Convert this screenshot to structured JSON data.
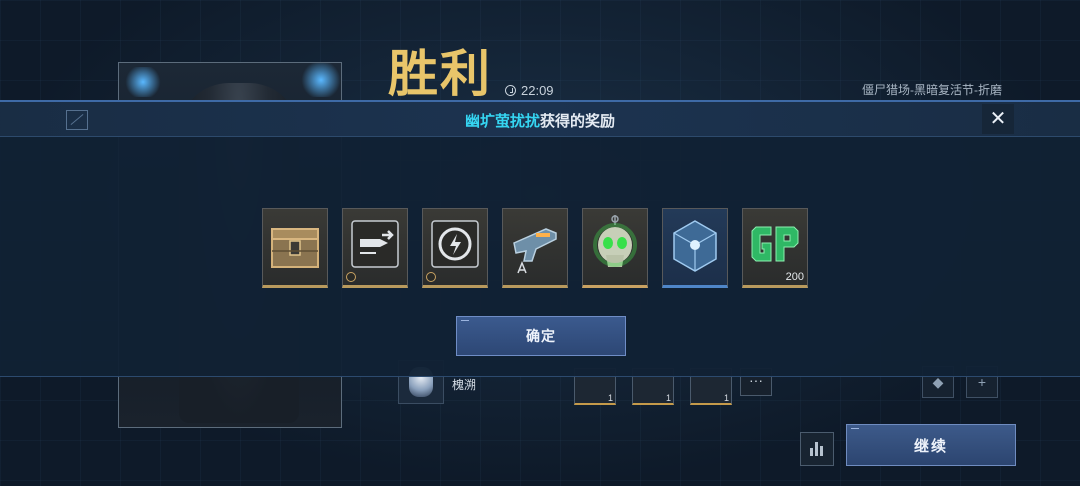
{
  "header": {
    "victory_title": "胜利",
    "match_time": "22:09",
    "mode_name": "僵尸猎场-黑暗复活节-折磨"
  },
  "modal": {
    "player_name": "幽圹萤扰扰",
    "title_suffix": "获得的奖励",
    "close_label": "✕",
    "confirm_label": "确定",
    "rewards": [
      {
        "name": "supply-crate",
        "icon": "crate-icon",
        "count": ""
      },
      {
        "name": "ammo-upgrade",
        "icon": "bullet-icon",
        "count": ""
      },
      {
        "name": "skill-boost",
        "icon": "lightning-target-icon",
        "count": ""
      },
      {
        "name": "weapon-blueprint",
        "icon": "pistol-icon",
        "count": ""
      },
      {
        "name": "skull-pendant",
        "icon": "skull-icon",
        "count": ""
      },
      {
        "name": "energy-core",
        "icon": "cube-icon",
        "count": ""
      },
      {
        "name": "gp-currency",
        "icon": "gp-icon",
        "count": "200"
      }
    ]
  },
  "background": {
    "teammate_name": "槐溯",
    "slot_counts": [
      "1",
      "1",
      "1"
    ],
    "more_label": "···",
    "continue_label": "继续"
  },
  "colors": {
    "victory_gold": "#e8c56a",
    "player_cyan": "#35d5f2",
    "button_blue": "#2d4775"
  }
}
